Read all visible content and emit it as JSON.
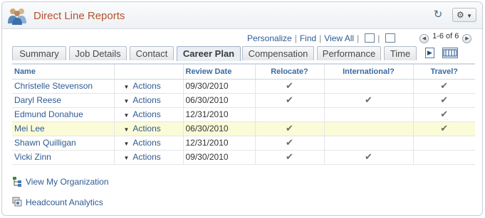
{
  "header": {
    "title": "Direct Line Reports",
    "refresh_icon": "refresh-icon",
    "gear_icon": "gear-icon"
  },
  "toolbar": {
    "personalize": "Personalize",
    "find": "Find",
    "view_all": "View All",
    "pagination": "1-6 of 6"
  },
  "tabs": [
    {
      "label": "Summary"
    },
    {
      "label": "Job Details"
    },
    {
      "label": "Contact"
    },
    {
      "label": "Career Plan",
      "active": true
    },
    {
      "label": "Compensation"
    },
    {
      "label": "Performance"
    },
    {
      "label": "Time"
    }
  ],
  "table": {
    "columns": [
      "Name",
      "",
      "Review Date",
      "Relocate?",
      "International?",
      "Travel?"
    ],
    "rows": [
      {
        "name": "Christelle Stevenson",
        "actions": "Actions",
        "review_date": "09/30/2010",
        "relocate": true,
        "international": false,
        "travel": true
      },
      {
        "name": "Daryl Reese",
        "actions": "Actions",
        "review_date": "06/30/2010",
        "relocate": true,
        "international": true,
        "travel": true
      },
      {
        "name": "Edmund Donahue",
        "actions": "Actions",
        "review_date": "12/31/2010",
        "relocate": false,
        "international": false,
        "travel": true
      },
      {
        "name": "Mei Lee",
        "actions": "Actions",
        "review_date": "06/30/2010",
        "relocate": true,
        "international": false,
        "travel": true,
        "highlighted": true
      },
      {
        "name": "Shawn Quilligan",
        "actions": "Actions",
        "review_date": "12/31/2010",
        "relocate": true,
        "international": false,
        "travel": false
      },
      {
        "name": "Vicki Zinn",
        "actions": "Actions",
        "review_date": "09/30/2010",
        "relocate": true,
        "international": true,
        "travel": false
      }
    ]
  },
  "footer": {
    "view_org": "View My Organization",
    "headcount": "Headcount Analytics"
  },
  "colors": {
    "title": "#b8512d",
    "link": "#2f5a93",
    "header_text": "#3c6aa0",
    "highlight": "#fbfbd8"
  }
}
